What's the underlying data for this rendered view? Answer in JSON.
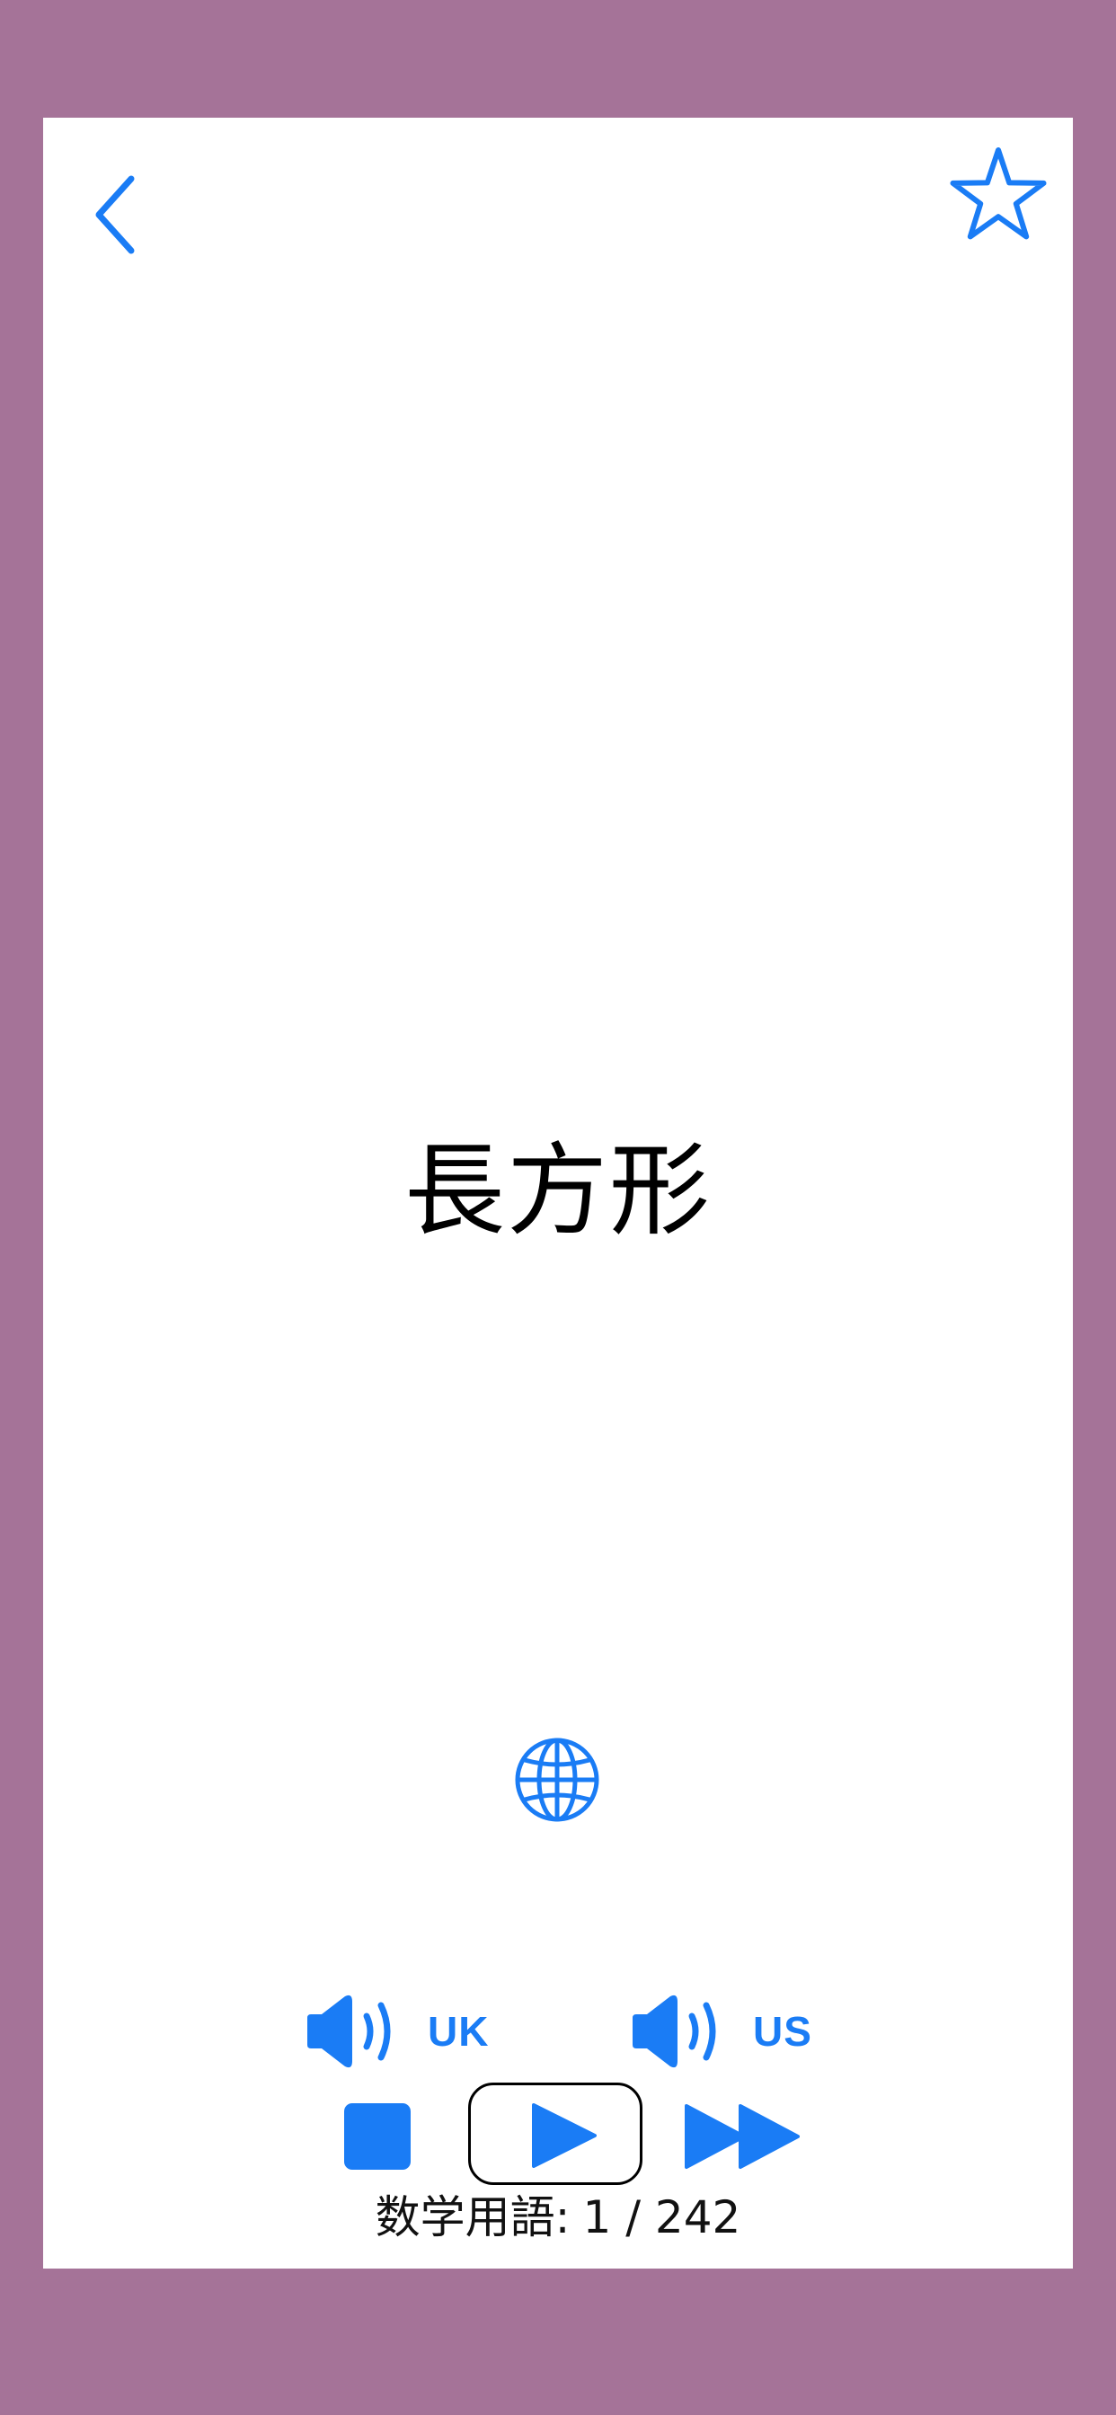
{
  "colors": {
    "background": "#a57398",
    "card": "#ffffff",
    "accent": "#1a7cf5",
    "text": "#000000"
  },
  "icons": {
    "back": "chevron-left-icon",
    "favorite": "star-outline-icon",
    "translate": "globe-icon",
    "speaker": "speaker-wave-icon",
    "stop": "stop-icon",
    "play": "play-icon",
    "next": "fast-forward-icon"
  },
  "card": {
    "term": "長方形"
  },
  "audio": {
    "uk_label": "UK",
    "us_label": "US"
  },
  "footer": {
    "category": "数学用語:",
    "position": "1 / 242"
  }
}
